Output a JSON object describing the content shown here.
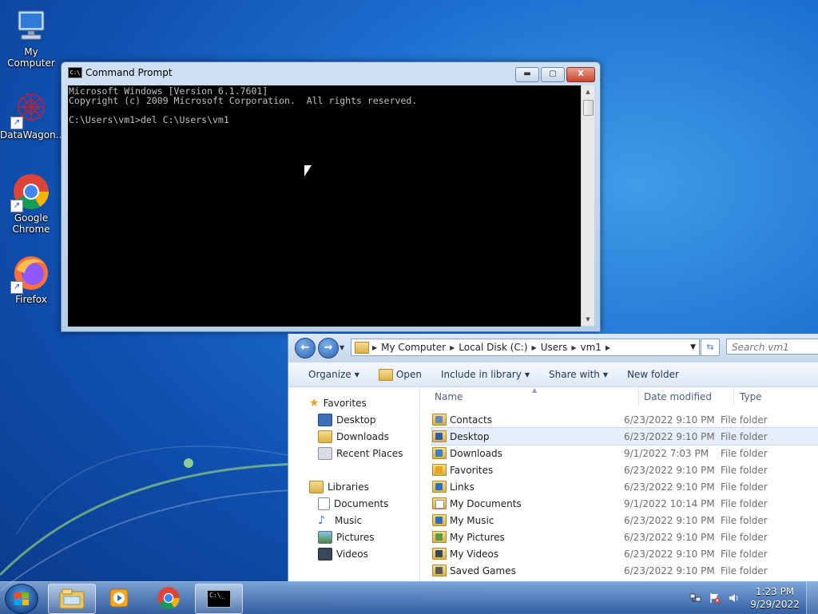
{
  "desktop": {
    "icons": [
      {
        "label": "My Computer"
      },
      {
        "label": "DataWagon..."
      },
      {
        "label": "Google Chrome"
      },
      {
        "label": "Firefox"
      }
    ]
  },
  "cmd": {
    "title": "Command Prompt",
    "icon_text": "C:\\",
    "lines": [
      "Microsoft Windows [Version 6.1.7601]",
      "Copyright (c) 2009 Microsoft Corporation.  All rights reserved.",
      "",
      "C:\\Users\\vm1>del C:\\Users\\vm1"
    ],
    "minimize": "▬",
    "maximize": "▢",
    "close": "X"
  },
  "explorer": {
    "breadcrumb": [
      "My Computer",
      "Local Disk (C:)",
      "Users",
      "vm1"
    ],
    "search_placeholder": "Search vm1",
    "toolbar": {
      "organize": "Organize",
      "open": "Open",
      "include": "Include in library",
      "share": "Share with",
      "new_folder": "New folder"
    },
    "nav": {
      "favorites": "Favorites",
      "desktop": "Desktop",
      "downloads": "Downloads",
      "recent": "Recent Places",
      "libraries": "Libraries",
      "documents": "Documents",
      "music": "Music",
      "pictures": "Pictures",
      "videos": "Videos"
    },
    "columns": {
      "name": "Name",
      "date": "Date modified",
      "type": "Type"
    },
    "files": [
      {
        "name": "Contacts",
        "date": "6/23/2022 9:10 PM",
        "type": "File folder"
      },
      {
        "name": "Desktop",
        "date": "6/23/2022 9:10 PM",
        "type": "File folder"
      },
      {
        "name": "Downloads",
        "date": "9/1/2022 7:03 PM",
        "type": "File folder"
      },
      {
        "name": "Favorites",
        "date": "6/23/2022 9:10 PM",
        "type": "File folder"
      },
      {
        "name": "Links",
        "date": "6/23/2022 9:10 PM",
        "type": "File folder"
      },
      {
        "name": "My Documents",
        "date": "9/1/2022 10:14 PM",
        "type": "File folder"
      },
      {
        "name": "My Music",
        "date": "6/23/2022 9:10 PM",
        "type": "File folder"
      },
      {
        "name": "My Pictures",
        "date": "6/23/2022 9:10 PM",
        "type": "File folder"
      },
      {
        "name": "My Videos",
        "date": "6/23/2022 9:10 PM",
        "type": "File folder"
      },
      {
        "name": "Saved Games",
        "date": "6/23/2022 9:10 PM",
        "type": "File folder"
      }
    ]
  },
  "taskbar": {
    "time": "1:23 PM",
    "date": "9/29/2022",
    "cmd_icon_text": "C:\\_"
  }
}
